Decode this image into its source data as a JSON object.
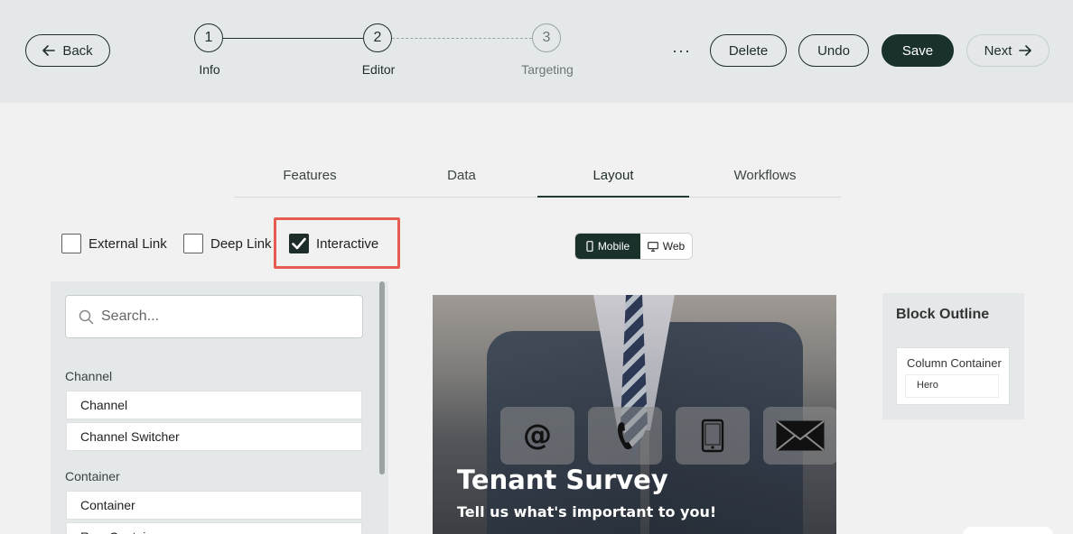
{
  "header": {
    "back_label": "Back",
    "steps": [
      {
        "number": "1",
        "label": "Info"
      },
      {
        "number": "2",
        "label": "Editor"
      },
      {
        "number": "3",
        "label": "Targeting"
      }
    ],
    "more_label": "···",
    "delete_label": "Delete",
    "undo_label": "Undo",
    "save_label": "Save",
    "next_label": "Next"
  },
  "tabs": [
    {
      "label": "Features",
      "active": false
    },
    {
      "label": "Data",
      "active": false
    },
    {
      "label": "Layout",
      "active": true
    },
    {
      "label": "Workflows",
      "active": false
    }
  ],
  "options": {
    "external_link": {
      "label": "External Link",
      "checked": false
    },
    "deep_link": {
      "label": "Deep Link",
      "checked": false
    },
    "interactive": {
      "label": "Interactive",
      "checked": true
    }
  },
  "view_toggle": {
    "mobile_label": "Mobile",
    "web_label": "Web",
    "selected": "Mobile"
  },
  "left_panel": {
    "search_placeholder": "Search...",
    "sections": [
      {
        "title": "Channel",
        "items": [
          "Channel",
          "Channel Switcher"
        ]
      },
      {
        "title": "Container",
        "items": [
          "Container",
          "Row Container"
        ]
      }
    ]
  },
  "preview": {
    "title": "Tenant Survey",
    "subtitle": "Tell us what's important to you!",
    "tile_icons": [
      "at-sign-icon",
      "phone-icon",
      "tablet-icon",
      "envelope-icon"
    ]
  },
  "outline": {
    "title": "Block Outline",
    "root": "Column Container",
    "child": "Hero"
  },
  "colors": {
    "brand_dark": "#19302b",
    "highlight": "#e65c4f",
    "header_bg": "#e4e8e9"
  }
}
